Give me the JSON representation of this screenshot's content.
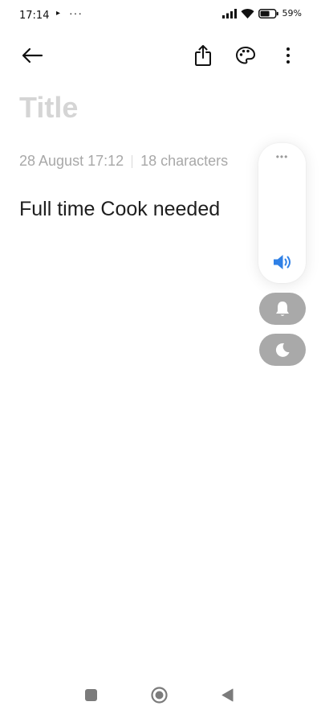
{
  "status_bar": {
    "time": "17:14",
    "play_glyph": "▸",
    "more_dots": "···",
    "battery_percent": "59%",
    "icons": [
      "signal-icon",
      "wifi-icon",
      "battery-icon"
    ]
  },
  "toolbar": {
    "back_icon": "arrow-left-icon",
    "share_icon": "share-icon",
    "theme_icon": "palette-icon",
    "more_icon": "more-vertical-icon"
  },
  "note": {
    "title_placeholder": "Title",
    "date": "28 August 17:12",
    "char_count": "18 characters",
    "body": "Full time Cook needed"
  },
  "volume_panel": {
    "more_dots": "•••",
    "speaker_icon": "volume-icon",
    "bell_icon": "bell-icon",
    "moon_icon": "moon-icon"
  },
  "colors": {
    "accent": "#2f80e6",
    "pill_bg": "#a9a9a9",
    "title_placeholder": "#d5d5d5",
    "meta_text": "#a8a8a8",
    "body_text": "#1e1e1e"
  },
  "nav_bar": {
    "icons": [
      "recents-square-icon",
      "home-circle-icon",
      "back-triangle-icon"
    ]
  }
}
